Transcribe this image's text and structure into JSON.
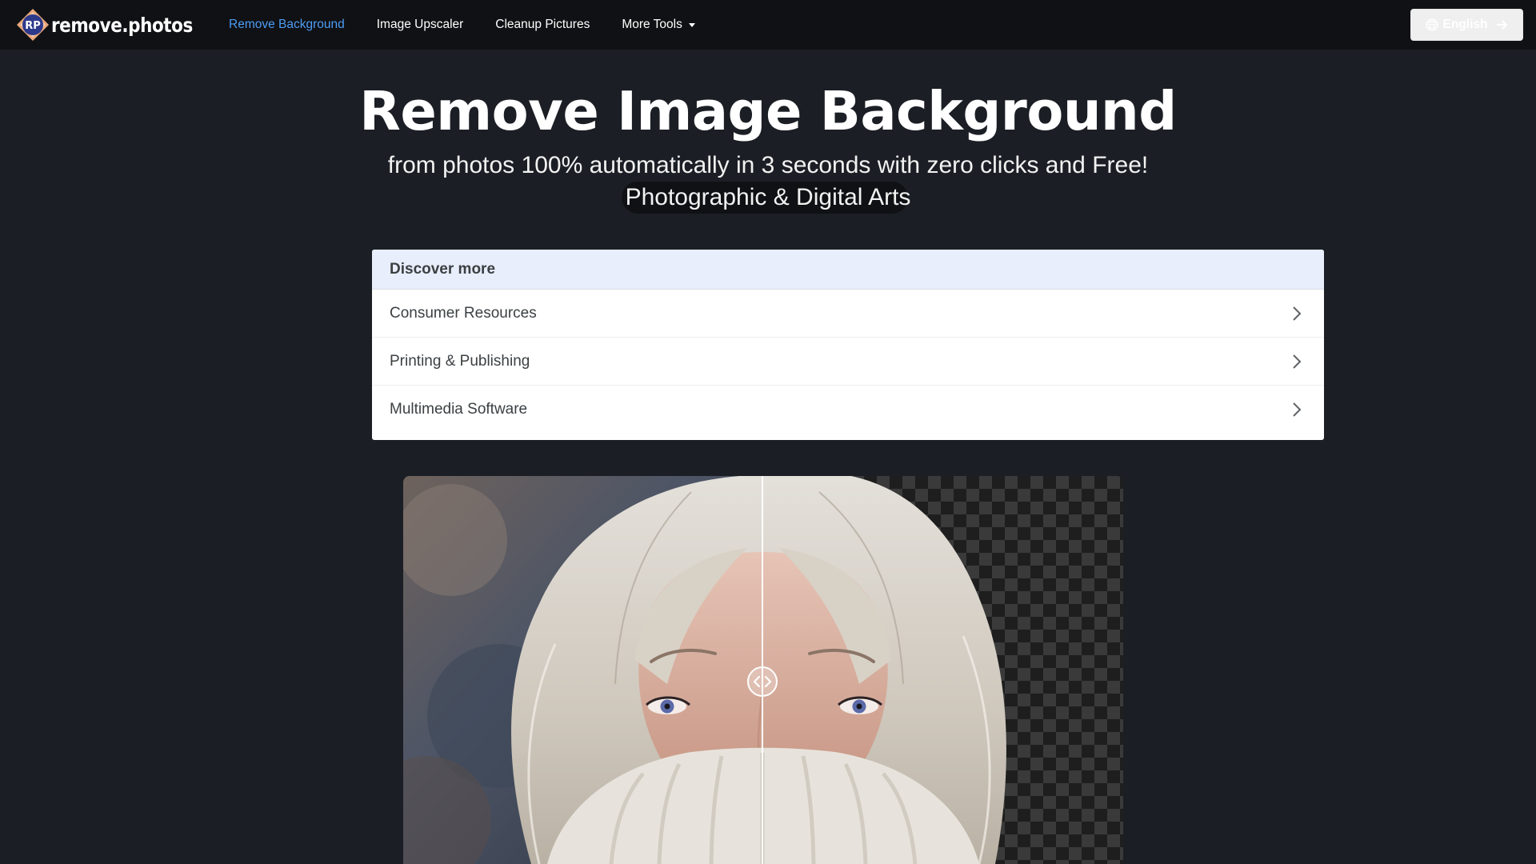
{
  "nav": {
    "brand": "remove.photos",
    "links": [
      {
        "label": "Remove Background",
        "active": true
      },
      {
        "label": "Image Upscaler",
        "active": false
      },
      {
        "label": "Cleanup Pictures",
        "active": false
      },
      {
        "label": "More Tools",
        "active": false
      }
    ],
    "language": "English"
  },
  "hero": {
    "title": "Remove Image Background",
    "subtitle": "from photos 100% automatically in 3 seconds with zero clicks and Free!",
    "tag": "Photographic & Digital Arts"
  },
  "discover": {
    "heading": "Discover more",
    "items": [
      {
        "label": "Consumer Resources"
      },
      {
        "label": "Printing & Publishing"
      },
      {
        "label": "Multimedia Software"
      }
    ]
  },
  "compare": {
    "split_percent": 50
  },
  "colors": {
    "page_bg": "#1b1f25",
    "nav_bg": "#101114",
    "active_link": "#4d9cf5",
    "panel_header": "#e8eefb"
  },
  "icons": {
    "brand": "rp-logo-icon",
    "language": "globe-icon",
    "language_action": "arrow-right-icon",
    "tag": "newspaper-icon",
    "discover_item": "chevron-right-icon",
    "compare_handle": "split-arrows-icon"
  }
}
